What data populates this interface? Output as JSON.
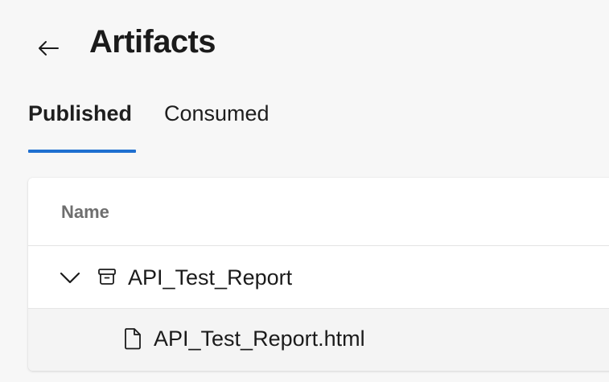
{
  "header": {
    "title": "Artifacts",
    "back_icon": "arrow-left-icon"
  },
  "tabs": [
    {
      "label": "Published",
      "selected": true
    },
    {
      "label": "Consumed",
      "selected": false
    }
  ],
  "colors": {
    "accent": "#1f6fd0",
    "background": "#f7f7f7",
    "card": "#ffffff",
    "child_row": "#f4f4f4"
  },
  "table": {
    "columns": [
      {
        "label": "Name"
      }
    ],
    "rows": [
      {
        "label": "API_Test_Report",
        "icon": "archive-icon",
        "expand_icon": "chevron-down-icon",
        "expanded": true,
        "children": [
          {
            "label": "API_Test_Report.html",
            "icon": "file-icon"
          }
        ]
      }
    ]
  }
}
